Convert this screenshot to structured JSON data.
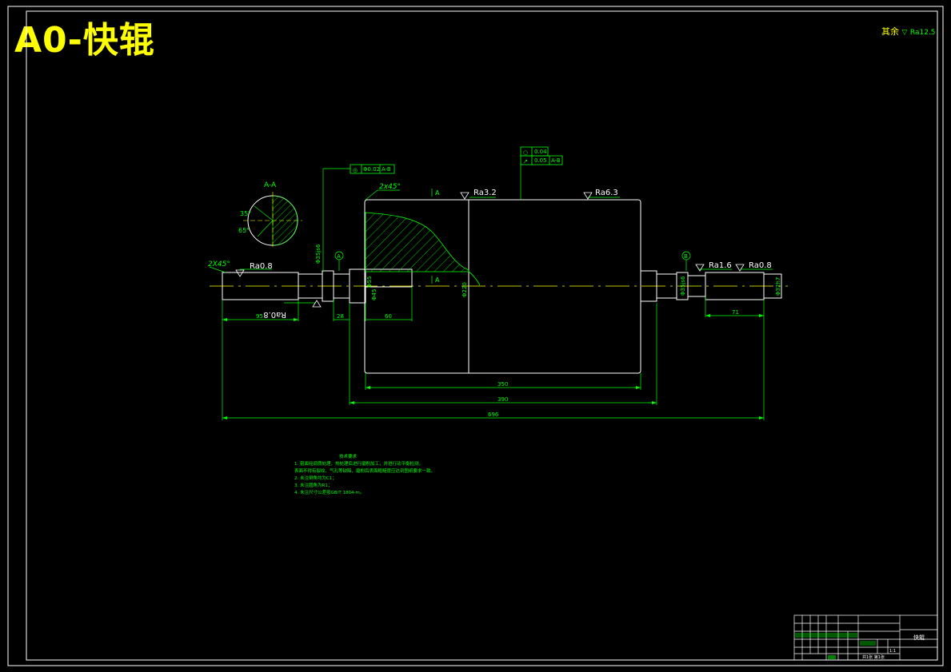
{
  "title": "A0-快辊",
  "colors": {
    "background": "#000000",
    "title": "#ffff00",
    "outline": "#ffffff",
    "dimension": "#00ff00",
    "centerline": "#ffff00",
    "hatch": "#00ff00"
  },
  "rest_roughness": {
    "label": "其余",
    "value": "Ra12.5"
  },
  "section": {
    "label": "A-A",
    "angle_1": "35°",
    "angle_2": "65°"
  },
  "tolerances": {
    "left_frame": {
      "symbol": "◎",
      "value": "Φ0.02",
      "datum": "A-B"
    },
    "top_frame_1": {
      "symbol": "○",
      "value": "0.04"
    },
    "top_frame_2": {
      "symbol": "↗",
      "value": "0.05",
      "datum": "A-B"
    }
  },
  "chamfers": {
    "left": "2X45°",
    "top": "2x45°"
  },
  "roughness": {
    "left_end": "Ra0.8",
    "left_bearing": "Ra0.8",
    "roller_left": "Ra3.2",
    "roller_top": "Ra6.3",
    "right_1": "Ra1.6",
    "right_2": "Ra0.8"
  },
  "datums": {
    "a": "A",
    "b": "B"
  },
  "section_mark": "A",
  "diameters": {
    "left_bearing": "Φ35js6",
    "neck_1": "Φ55",
    "neck_2": "Φ45",
    "roller": "Φ220",
    "right_bearing": "Φ35js6",
    "right_end": "Φ32h7"
  },
  "dimensions": {
    "d95": "95",
    "d28": "28",
    "d60": "60",
    "d71": "71",
    "d350": "350",
    "d390": "390",
    "d696": "696"
  },
  "notes": {
    "heading": "技术要求",
    "lines": [
      "1. 辊面经调质处理，热处理后进行磨削加工，并进行动平衡检测，",
      "   表面不得有裂纹、气孔等缺陷，磨削后表面粗糙度应达到图纸要求一致。",
      "2. 未注倒角均为C1；",
      "3. 未注圆角为R1；",
      "4. 未注尺寸公差按GB/T 1804-m。"
    ]
  },
  "title_block": {
    "part_name": "快辊",
    "scale": "1:1",
    "sheet": "共1张 第1张"
  }
}
